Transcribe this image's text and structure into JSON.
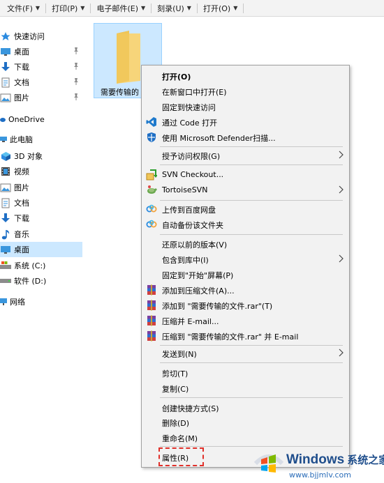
{
  "toolbar": {
    "items": [
      {
        "label": "文件(F)"
      },
      {
        "label": "打印(P)"
      },
      {
        "label": "电子邮件(E)"
      },
      {
        "label": "刻录(U)"
      },
      {
        "label": "打开(O)"
      }
    ]
  },
  "nav": {
    "quick_access": "快速访问",
    "qa_desktop": "桌面",
    "qa_downloads": "下载",
    "qa_documents": "文档",
    "qa_pictures": "图片",
    "onedrive": "OneDrive",
    "this_pc": "此电脑",
    "objects3d": "3D 对象",
    "videos": "视频",
    "pictures": "图片",
    "documents": "文档",
    "downloads": "下载",
    "music": "音乐",
    "desktop": "桌面",
    "system_c": "系统 (C:)",
    "software_d": "软件 (D:)",
    "network": "网络"
  },
  "content": {
    "folder_name": "需要传输的"
  },
  "menu": {
    "open": "打开(O)",
    "open_new_window": "在新窗口中打开(E)",
    "pin_quick_access": "固定到快速访问",
    "open_with_code": "通过 Code 打开",
    "defender_scan": "使用 Microsoft Defender扫描...",
    "grant_access": "授予访问权限(G)",
    "svn_checkout": "SVN Checkout...",
    "tortoise_svn": "TortoiseSVN",
    "upload_baidu": "上传到百度网盘",
    "auto_backup": "自动备份该文件夹",
    "restore_previous": "还原以前的版本(V)",
    "include_library": "包含到库中(I)",
    "pin_start": "固定到\"开始\"屏幕(P)",
    "add_archive": "添加到压缩文件(A)...",
    "add_to_rar": "添加到 \"需要传输的文件.rar\"(T)",
    "compress_email": "压缩并 E-mail...",
    "compress_rar_email": "压缩到 \"需要传输的文件.rar\" 并 E-mail",
    "send_to": "发送到(N)",
    "cut": "剪切(T)",
    "copy": "复制(C)",
    "create_shortcut": "创建快捷方式(S)",
    "delete": "删除(D)",
    "rename": "重命名(M)",
    "properties": "属性(R)"
  },
  "watermark": {
    "brand": "Windows",
    "brand_cn": "系统之家",
    "url": "www.bjjmlv.com"
  },
  "colors": {
    "selection": "#cce8ff",
    "menu_bg": "#f2f2f2",
    "highlight_dash": "#e0302a",
    "folder": "#f7d57a"
  }
}
